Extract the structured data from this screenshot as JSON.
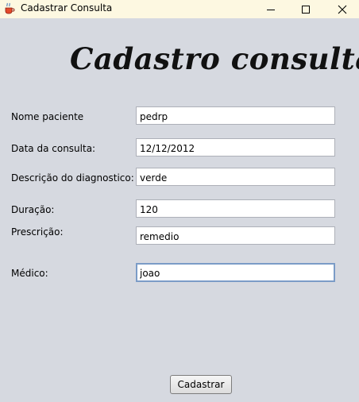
{
  "window": {
    "title": "Cadastrar Consulta",
    "app_icon": "java-coffee-cup-icon",
    "controls": {
      "minimize": "minimize-icon",
      "maximize": "maximize-icon",
      "close": "close-icon"
    }
  },
  "heading": "Cadastro consulta",
  "form": {
    "nome_paciente": {
      "label": "Nome paciente",
      "value": "pedrp"
    },
    "data_consulta": {
      "label": "Data da consulta:",
      "value": "12/12/2012"
    },
    "descricao": {
      "label": "Descrição do diagnostico:",
      "value": "verde"
    },
    "duracao": {
      "label": "Duração:",
      "value": "120"
    },
    "prescricao": {
      "label": "Prescrição:",
      "value": "remedio"
    },
    "medico": {
      "label": "Médico:",
      "value": "joao"
    }
  },
  "submit_label": "Cadastrar",
  "colors": {
    "background": "#d6d9e0",
    "titlebar": "#fdf8e1",
    "focus_border": "#7b9cc7"
  }
}
